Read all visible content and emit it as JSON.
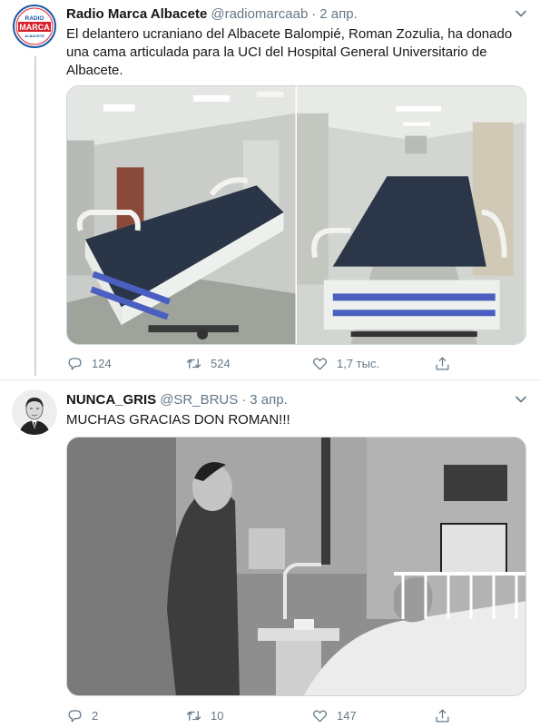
{
  "tweets": [
    {
      "author_name": "Radio Marca Albacete",
      "handle": "@radiomarcaab",
      "separator": "·",
      "date": "2 апр.",
      "avatar_logo": {
        "top": "RADIO",
        "main": "MARCA",
        "bottom": "ALBACETE"
      },
      "text": "El delantero ucraniano del Albacete Balompié, Roman Zozulia, ha donado una cama articulada para la UCI del Hospital General Universitario de Albacete.",
      "media": [
        "hospital-bed-photo-1",
        "hospital-bed-photo-2"
      ],
      "replies": "124",
      "retweets": "524",
      "likes": "1,7 тыс."
    },
    {
      "author_name": "NUNCA_GRIS",
      "handle": "@SR_BRUS",
      "separator": "·",
      "date": "3 апр.",
      "text": "MUCHAS GRACIAS DON ROMAN!!!",
      "media": [
        "black-and-white-hospital-photo"
      ],
      "replies": "2",
      "retweets": "10",
      "likes": "147"
    }
  ],
  "icons": [
    "caret-down-icon",
    "reply-icon",
    "retweet-icon",
    "like-icon",
    "share-icon"
  ],
  "colors": {
    "text": "#14171a",
    "secondary": "#657786",
    "divider": "#e6ecf0",
    "brand_blue": "#1d5aa8",
    "brand_red": "#d71f2b"
  }
}
